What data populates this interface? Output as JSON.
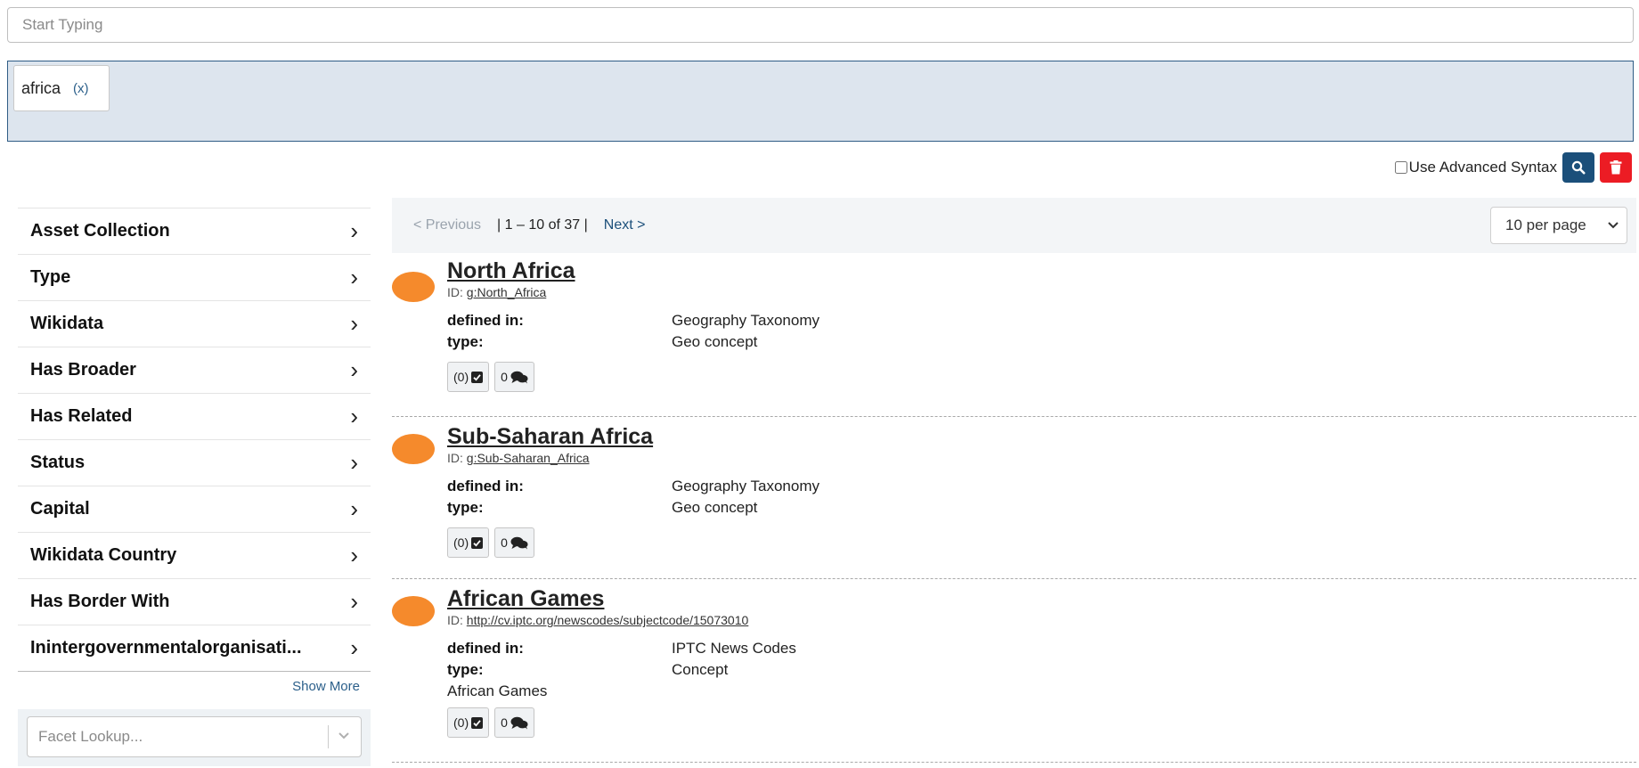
{
  "search": {
    "placeholder": "Start Typing"
  },
  "chips": [
    {
      "label": "africa",
      "remove": "(x)"
    }
  ],
  "advanced": {
    "label": "Use Advanced Syntax"
  },
  "facets": {
    "items": [
      "Asset Collection",
      "Type",
      "Wikidata",
      "Has Broader",
      "Has Related",
      "Status",
      "Capital",
      "Wikidata Country",
      "Has Border With",
      "Inintergovernmentalorganisati..."
    ],
    "show_more": "Show More",
    "lookup_placeholder": "Facet Lookup..."
  },
  "pager": {
    "prev": "< Previous",
    "count": "| 1 – 10 of 37 |",
    "next": "Next >",
    "per_page": "10 per page"
  },
  "results": [
    {
      "title": "North Africa",
      "id_label": "ID:",
      "id_value": "g:North_Africa",
      "fields": [
        {
          "label": "defined in:",
          "value": "Geography Taxonomy"
        },
        {
          "label": "type:",
          "value": "Geo concept"
        }
      ],
      "extra": "",
      "count1": "(0)",
      "count2": "0"
    },
    {
      "title": "Sub-Saharan Africa",
      "id_label": "ID:",
      "id_value": "g:Sub-Saharan_Africa",
      "fields": [
        {
          "label": "defined in:",
          "value": "Geography Taxonomy"
        },
        {
          "label": "type:",
          "value": "Geo concept"
        }
      ],
      "extra": "",
      "count1": "(0)",
      "count2": "0"
    },
    {
      "title": "African Games",
      "id_label": "ID:",
      "id_value": "http://cv.iptc.org/newscodes/subjectcode/15073010",
      "fields": [
        {
          "label": "defined in:",
          "value": "IPTC News Codes"
        },
        {
          "label": "type:",
          "value": "Concept"
        }
      ],
      "extra": "African Games",
      "count1": "(0)",
      "count2": "0"
    }
  ],
  "colors": {
    "accent": "#1b4f7a",
    "danger": "#ec1c24",
    "dot": "#f58a2c",
    "chips_bg": "#dde5ee"
  }
}
